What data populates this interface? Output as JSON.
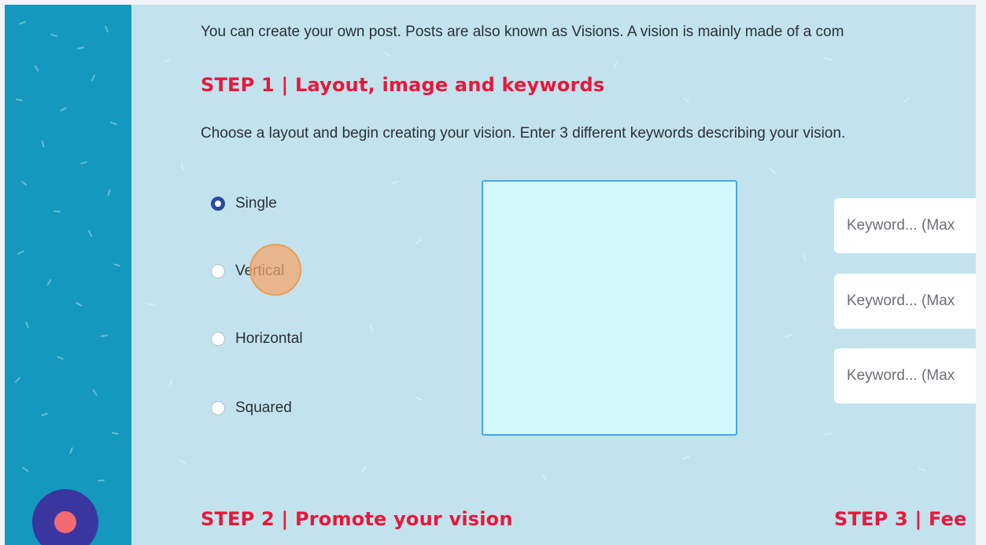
{
  "intro_text": "You can create your own post. Posts are also known as Visions. A vision is mainly made of a com",
  "step1": {
    "title": "STEP 1 | Layout, image and keywords",
    "instruction": "Choose a layout and begin creating your vision. Enter 3 different keywords describing your vision.",
    "layout_options": [
      "Single",
      "Vertical",
      "Horizontal",
      "Squared"
    ],
    "selected_layout": "Single",
    "keyword_placeholder": "Keyword... (Max"
  },
  "step2": {
    "title": "STEP 2 | Promote your vision"
  },
  "step3": {
    "title": "STEP 3 | Fee"
  },
  "colors": {
    "sidebar": "#1598bd",
    "background": "#c2e3ee",
    "heading": "#e8173b",
    "radio_checked": "#2d4a9c",
    "image_box": "#d3f9fc",
    "fab": "#3a36a0",
    "fab_dot": "#f16b71"
  }
}
